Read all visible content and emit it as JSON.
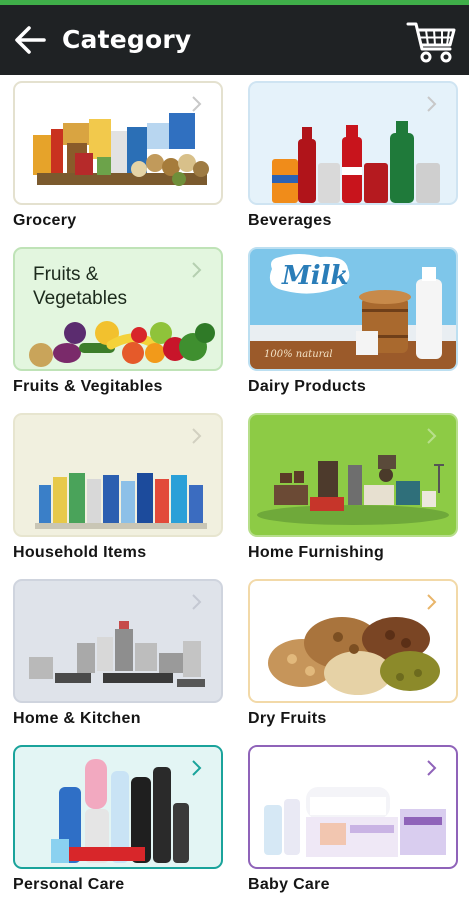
{
  "app_bar": {
    "title": "Category",
    "back_icon": "arrow-left-icon",
    "cart_icon": "shopping-cart-icon"
  },
  "colors": {
    "accent_stripe": "#3fae49",
    "app_bar_bg": "#1f2224"
  },
  "categories": [
    {
      "label": "Grocery",
      "tile_bg": "#ffffff",
      "border": "#e4e1cf"
    },
    {
      "label": "Beverages",
      "tile_bg": "#e5f2fa",
      "border": "#cfe4f2"
    },
    {
      "label": "Fruits & Vegitables",
      "tile_text": "Fruits &\nVegetables",
      "tile_bg": "#e3f6df",
      "border": "#bfe3b7"
    },
    {
      "label": "Dairy Products",
      "tile_bg": "#7ec6ea",
      "border": "#bcdff1",
      "tile_text": "Milk",
      "tile_subtext": "100% natural"
    },
    {
      "label": "Household Items",
      "tile_bg": "#f1f0df",
      "border": "#e7e5cf"
    },
    {
      "label": "Home Furnishing",
      "tile_bg": "#8dcb45",
      "border": "#b7de8b"
    },
    {
      "label": "Home & Kitchen",
      "tile_bg": "#dfe3ea",
      "border": "#cfd4de"
    },
    {
      "label": "Dry Fruits",
      "tile_bg": "#ffffff",
      "border": "#f2d9a8"
    },
    {
      "label": "Personal Care",
      "tile_bg": "#e3f5f4",
      "border": "#1aa39b"
    },
    {
      "label": "Baby Care",
      "tile_bg": "#ffffff",
      "border": "#8f63b9"
    }
  ]
}
